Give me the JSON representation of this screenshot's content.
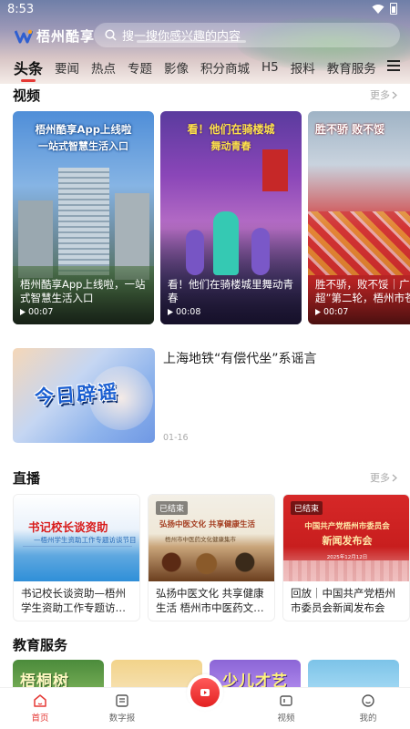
{
  "status_bar": {
    "time": "8:53"
  },
  "header": {
    "logo_text": "梧州酷享",
    "search_placeholder": "搜一搜你感兴趣的内容",
    "tabs": [
      "头条",
      "要闻",
      "热点",
      "专题",
      "影像",
      "积分商城",
      "H5",
      "报料",
      "教育服务"
    ],
    "active_tab": "头条"
  },
  "video_section": {
    "title": "视频",
    "more": "更多",
    "cards": [
      {
        "banner1": "梧州酷享App上线啦",
        "banner2": "一站式智慧生活入口",
        "caption": "梧州酷享App上线啦，一站式智慧生活入口",
        "duration": "00:07"
      },
      {
        "banner1": "看！他们在骑楼城",
        "banner2": "舞动青春",
        "caption": "看！他们在骑楼城里舞动青春",
        "duration": "00:08"
      },
      {
        "banner1": "胜不骄 败不馁",
        "banner2": "",
        "caption": "胜不骄，败不馁｜广西“桂超”第二轮，梧州市苍梧县…",
        "duration": "00:07"
      }
    ]
  },
  "article": {
    "thumb_text": "今日辟谣",
    "title": "上海地铁“有偿代坐”系谣言",
    "date": "01-16"
  },
  "live_section": {
    "title": "直播",
    "more": "更多",
    "cards": [
      {
        "img_title": "书记校长谈资助",
        "img_sub": "—梧州学生资助工作专题访谈节目",
        "caption": "书记校长谈资助—梧州学生资助工作专题访…",
        "badge": ""
      },
      {
        "img_title": "弘扬中医文化  共享健康生活",
        "img_sub": "梧州市中医药文化健康集市",
        "caption": "弘扬中医文化 共享健康生活 梧州市中医药文…",
        "badge": "已结束"
      },
      {
        "img_title": "中国共产党梧州市委员会",
        "img_sub": "新闻发布会",
        "img_date": "2025年12月12日",
        "caption": "回放｜中国共产党梧州市委员会新闻发布会",
        "badge": "已结束"
      }
    ]
  },
  "education_section": {
    "title": "教育服务",
    "cards": [
      "梧桐树",
      "",
      "少儿才艺",
      ""
    ]
  },
  "bottom_nav": {
    "items": [
      "首页",
      "数字报",
      "",
      "视频",
      "我的"
    ],
    "active": "首页"
  },
  "colors": {
    "accent": "#e53935",
    "tab_text": "#333333"
  }
}
